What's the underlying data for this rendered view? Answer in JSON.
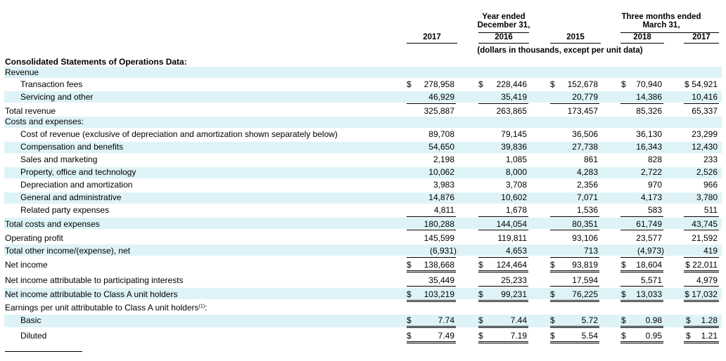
{
  "header": {
    "year_ended_line1": "Year ended",
    "year_ended_line2": "December 31,",
    "three_months_line1": "Three months ended",
    "three_months_line2": "March 31,",
    "col_2017": "2017",
    "col_2016": "2016",
    "col_2015": "2015",
    "col_q2018": "2018",
    "col_q2017": "2017",
    "units": "(dollars in thousands, except per unit data)"
  },
  "section_title": "Consolidated Statements of Operations Data:",
  "footnote_marker": "(1)",
  "rows": [
    {
      "label": "Revenue",
      "values": [
        "",
        "",
        "",
        "",
        ""
      ]
    },
    {
      "label": "Transaction fees",
      "values": [
        "278,958",
        "228,446",
        "152,678",
        "70,940",
        "54,921"
      ]
    },
    {
      "label": "Servicing and other",
      "values": [
        "46,929",
        "35,419",
        "20,779",
        "14,386",
        "10,416"
      ]
    },
    {
      "label": "Total revenue",
      "values": [
        "325,887",
        "263,865",
        "173,457",
        "85,326",
        "65,337"
      ]
    },
    {
      "label": "Costs and expenses:",
      "values": [
        "",
        "",
        "",
        "",
        ""
      ]
    },
    {
      "label": "Cost of revenue (exclusive of depreciation and amortization shown separately below)",
      "values": [
        "89,708",
        "79,145",
        "36,506",
        "36,130",
        "23,299"
      ]
    },
    {
      "label": "Compensation and benefits",
      "values": [
        "54,650",
        "39,836",
        "27,738",
        "16,343",
        "12,430"
      ]
    },
    {
      "label": "Sales and marketing",
      "values": [
        "2,198",
        "1,085",
        "861",
        "828",
        "233"
      ]
    },
    {
      "label": "Property, office and technology",
      "values": [
        "10,062",
        "8,000",
        "4,283",
        "2,722",
        "2,526"
      ]
    },
    {
      "label": "Depreciation and amortization",
      "values": [
        "3,983",
        "3,708",
        "2,356",
        "970",
        "966"
      ]
    },
    {
      "label": "General and administrative",
      "values": [
        "14,876",
        "10,602",
        "7,071",
        "4,173",
        "3,780"
      ]
    },
    {
      "label": "Related party expenses",
      "values": [
        "4,811",
        "1,678",
        "1,536",
        "583",
        "511"
      ]
    },
    {
      "label": "Total costs and expenses",
      "values": [
        "180,288",
        "144,054",
        "80,351",
        "61,749",
        "43,745"
      ]
    },
    {
      "label": "Operating profit",
      "values": [
        "145,599",
        "119,811",
        "93,106",
        "23,577",
        "21,592"
      ]
    },
    {
      "label": "Total other income/(expense), net",
      "values": [
        "(6,931)",
        "4,653",
        "713",
        "(4,973)",
        "419"
      ]
    },
    {
      "label": "Net income",
      "values": [
        "138,668",
        "124,464",
        "93,819",
        "18,604",
        "$ 22,011"
      ]
    },
    {
      "label": "Net income attributable to participating interests",
      "values": [
        "35,449",
        "25,233",
        "17,594",
        "5,571",
        "4,979"
      ]
    },
    {
      "label": "Net income attributable to Class A unit holders",
      "values": [
        "103,219",
        "99,231",
        "76,225",
        "13,033",
        "$ 17,032"
      ]
    },
    {
      "label": "Earnings per unit attributable to Class A unit holders",
      "values": [
        "",
        "",
        "",
        "",
        ""
      ]
    },
    {
      "label": "Basic",
      "values": [
        "7.74",
        "7.44",
        "5.72",
        "0.98",
        "1.28"
      ]
    },
    {
      "label": "Diluted",
      "values": [
        "7.49",
        "7.19",
        "5.54",
        "0.95",
        "1.21"
      ]
    }
  ],
  "dollar_sign": "$",
  "colon": ":",
  "band_color": "#def3f7"
}
